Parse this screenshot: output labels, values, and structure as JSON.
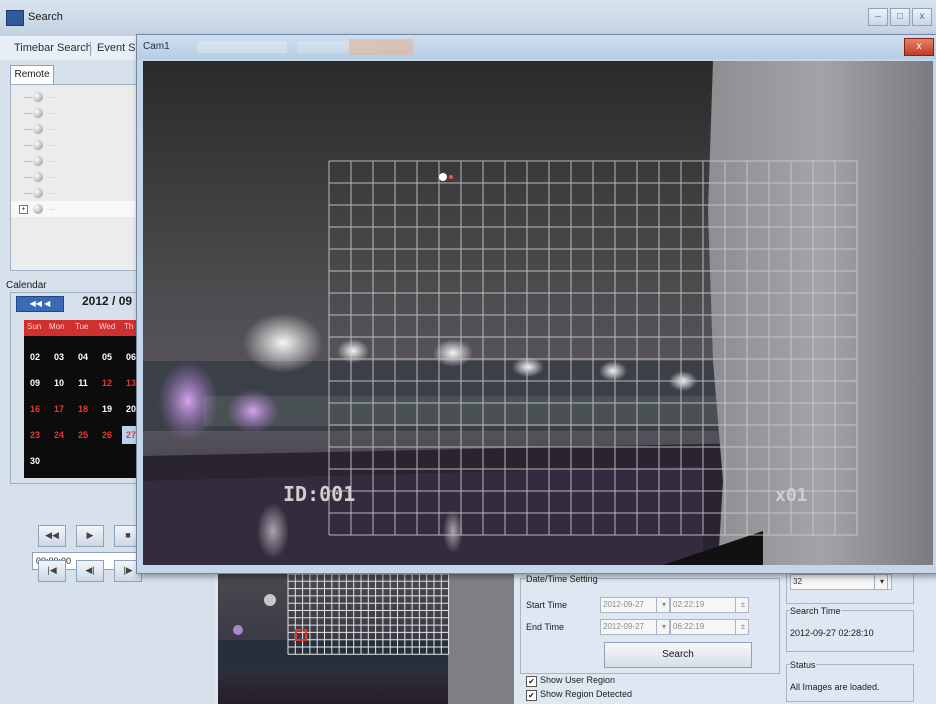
{
  "window": {
    "title": "Search",
    "icon": "app-icon",
    "minimize": "–",
    "maximize": "□",
    "close": "x"
  },
  "top_tabs": [
    "Timebar Search",
    "Event Se"
  ],
  "left_panel": {
    "remote_tab": "Remote",
    "tree_items": [
      "...",
      "...",
      "...",
      "...",
      "...",
      "...",
      "...",
      "..."
    ],
    "calendar": {
      "label": "Calendar",
      "nav": "◀◀ ◀",
      "month": "2012 / 09",
      "weekdays": [
        "Sun",
        "Mon",
        "Tue",
        "Wed",
        "Th"
      ],
      "rows": [
        [
          {
            "d": "02",
            "c": "#ffffff"
          },
          {
            "d": "03",
            "c": "#ffffff"
          },
          {
            "d": "04",
            "c": "#ffffff"
          },
          {
            "d": "05",
            "c": "#ffffff"
          },
          {
            "d": "06",
            "c": "#ffffff"
          }
        ],
        [
          {
            "d": "09",
            "c": "#ffffff"
          },
          {
            "d": "10",
            "c": "#ffffff"
          },
          {
            "d": "11",
            "c": "#ffffff"
          },
          {
            "d": "12",
            "c": "#e23a32"
          },
          {
            "d": "13",
            "c": "#e23a32"
          }
        ],
        [
          {
            "d": "16",
            "c": "#e23a32"
          },
          {
            "d": "17",
            "c": "#e23a32"
          },
          {
            "d": "18",
            "c": "#e23a32"
          },
          {
            "d": "19",
            "c": "#ffffff"
          },
          {
            "d": "20",
            "c": "#ffffff"
          }
        ],
        [
          {
            "d": "23",
            "c": "#e23a32"
          },
          {
            "d": "24",
            "c": "#e23a32"
          },
          {
            "d": "25",
            "c": "#e23a32"
          },
          {
            "d": "26",
            "c": "#e23a32"
          },
          {
            "d": "27",
            "c": "#e23a32",
            "sel": true
          }
        ],
        [
          {
            "d": "30",
            "c": "#ffffff"
          }
        ]
      ]
    },
    "time_value": "00:00:00",
    "playback_row1": [
      "◀◀",
      "▶",
      "■"
    ],
    "playback_row2": [
      "|◀",
      "◀|",
      "|▶"
    ]
  },
  "cam_window": {
    "title": "Cam1",
    "close": "x",
    "osd_id": "ID:001",
    "osd_right": "x01"
  },
  "datetime": {
    "title": "Date/Time Setting",
    "start_label": "Start Time",
    "start_date": "2012-09-27",
    "start_time": "02:22:19",
    "end_label": "End Time",
    "end_date": "2012-09-27",
    "end_time": "06:22:19",
    "search_button": "Search",
    "show_user_region": "Show User Region",
    "show_region_detected": "Show Region Detected",
    "checked_mark": "✔"
  },
  "right_info": {
    "count_value": "32",
    "search_time_label": "Search Time",
    "search_time_value": "2012-09-27 02:28:10",
    "status_label": "Status",
    "status_value": "All Images are loaded."
  },
  "colors": {
    "calendar_header": "#d1312e",
    "selected_day": "#b9d2f0",
    "grid_line": "#c8c8c8"
  }
}
